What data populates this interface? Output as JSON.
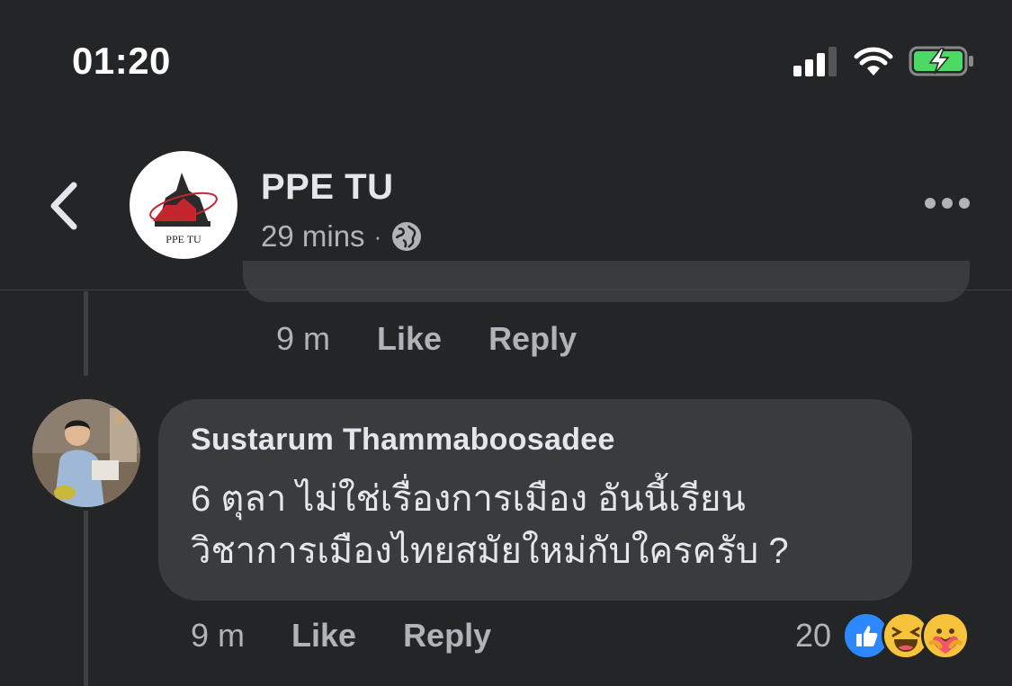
{
  "status_bar": {
    "time": "01:20"
  },
  "header": {
    "page_name": "PPE TU",
    "timestamp": "29 mins",
    "separator": "·",
    "logo_text": "PPE TU"
  },
  "previous_comment": {
    "time": "9 m",
    "like_label": "Like",
    "reply_label": "Reply"
  },
  "comment": {
    "author": "Sustarum Thammaboosadee",
    "text_line1": "6 ตุลา ไม่ใช่เรื่องการเมือง อันนี้เรียน",
    "text_line2": "วิชาการเมืองไทยสมัยใหม่กับใครครับ ?",
    "time": "9 m",
    "like_label": "Like",
    "reply_label": "Reply",
    "reaction_count": "20",
    "reaction_icons": [
      "like-icon",
      "haha-icon",
      "care-icon"
    ]
  },
  "colors": {
    "background": "#242526",
    "bubble": "#3a3b3c",
    "primary_text": "#e4e6eb",
    "secondary_text": "#b0b3b8",
    "like_blue": "#2d88ff",
    "reaction_yellow": "#f7c33c"
  }
}
